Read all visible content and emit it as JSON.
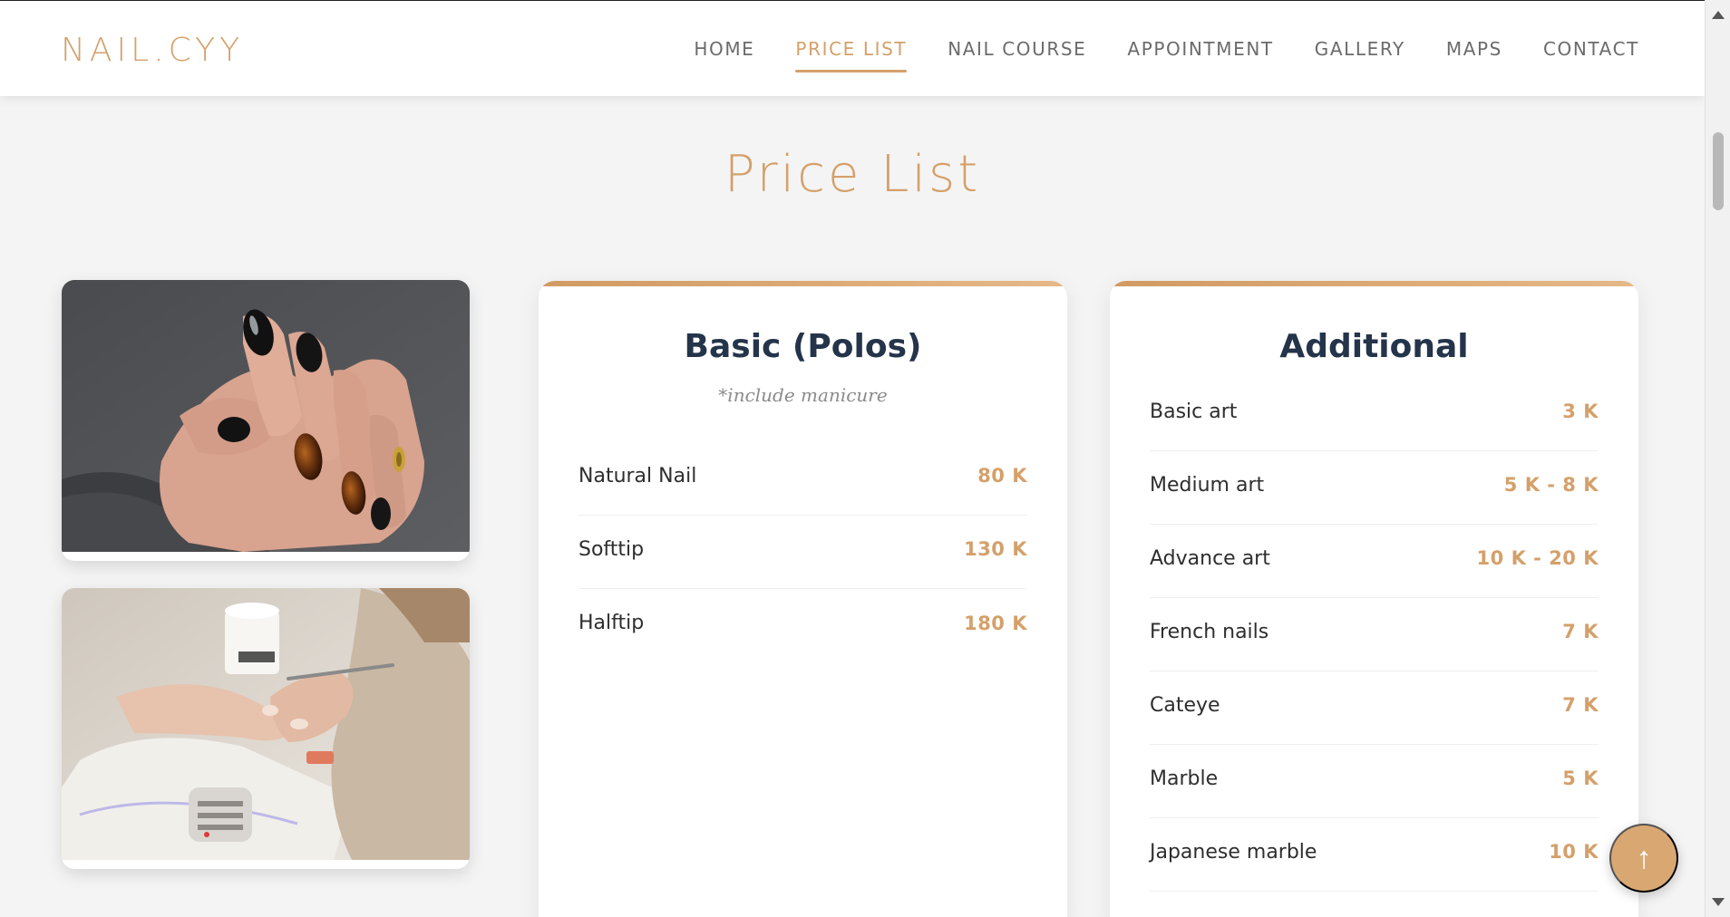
{
  "header": {
    "logo": "NAIL.CYY",
    "nav": [
      {
        "label": "HOME",
        "active": false
      },
      {
        "label": "PRICE LIST",
        "active": true
      },
      {
        "label": "NAIL COURSE",
        "active": false
      },
      {
        "label": "APPOINTMENT",
        "active": false
      },
      {
        "label": "GALLERY",
        "active": false
      },
      {
        "label": "MAPS",
        "active": false
      },
      {
        "label": "CONTACT",
        "active": false
      }
    ]
  },
  "main": {
    "title": "Price List",
    "basic": {
      "title": "Basic (Polos)",
      "note": "*include manicure",
      "items": [
        {
          "name": "Natural Nail",
          "price": "80 K"
        },
        {
          "name": "Softtip",
          "price": "130 K"
        },
        {
          "name": "Halftip",
          "price": "180 K"
        }
      ]
    },
    "additional": {
      "title": "Additional",
      "items": [
        {
          "name": "Basic art",
          "price": "3 K"
        },
        {
          "name": "Medium art",
          "price": "5 K - 8 K"
        },
        {
          "name": "Advance art",
          "price": "10 K - 20 K"
        },
        {
          "name": "French nails",
          "price": "7 K"
        },
        {
          "name": "Cateye",
          "price": "7 K"
        },
        {
          "name": "Marble",
          "price": "5 K"
        },
        {
          "name": "Japanese marble",
          "price": "10 K"
        }
      ]
    }
  },
  "to_top": {
    "icon": "arrow-up-icon",
    "glyph": "↑"
  },
  "colors": {
    "accent": "#d4a06a",
    "heading": "#24344a",
    "background": "#f4f4f4"
  }
}
